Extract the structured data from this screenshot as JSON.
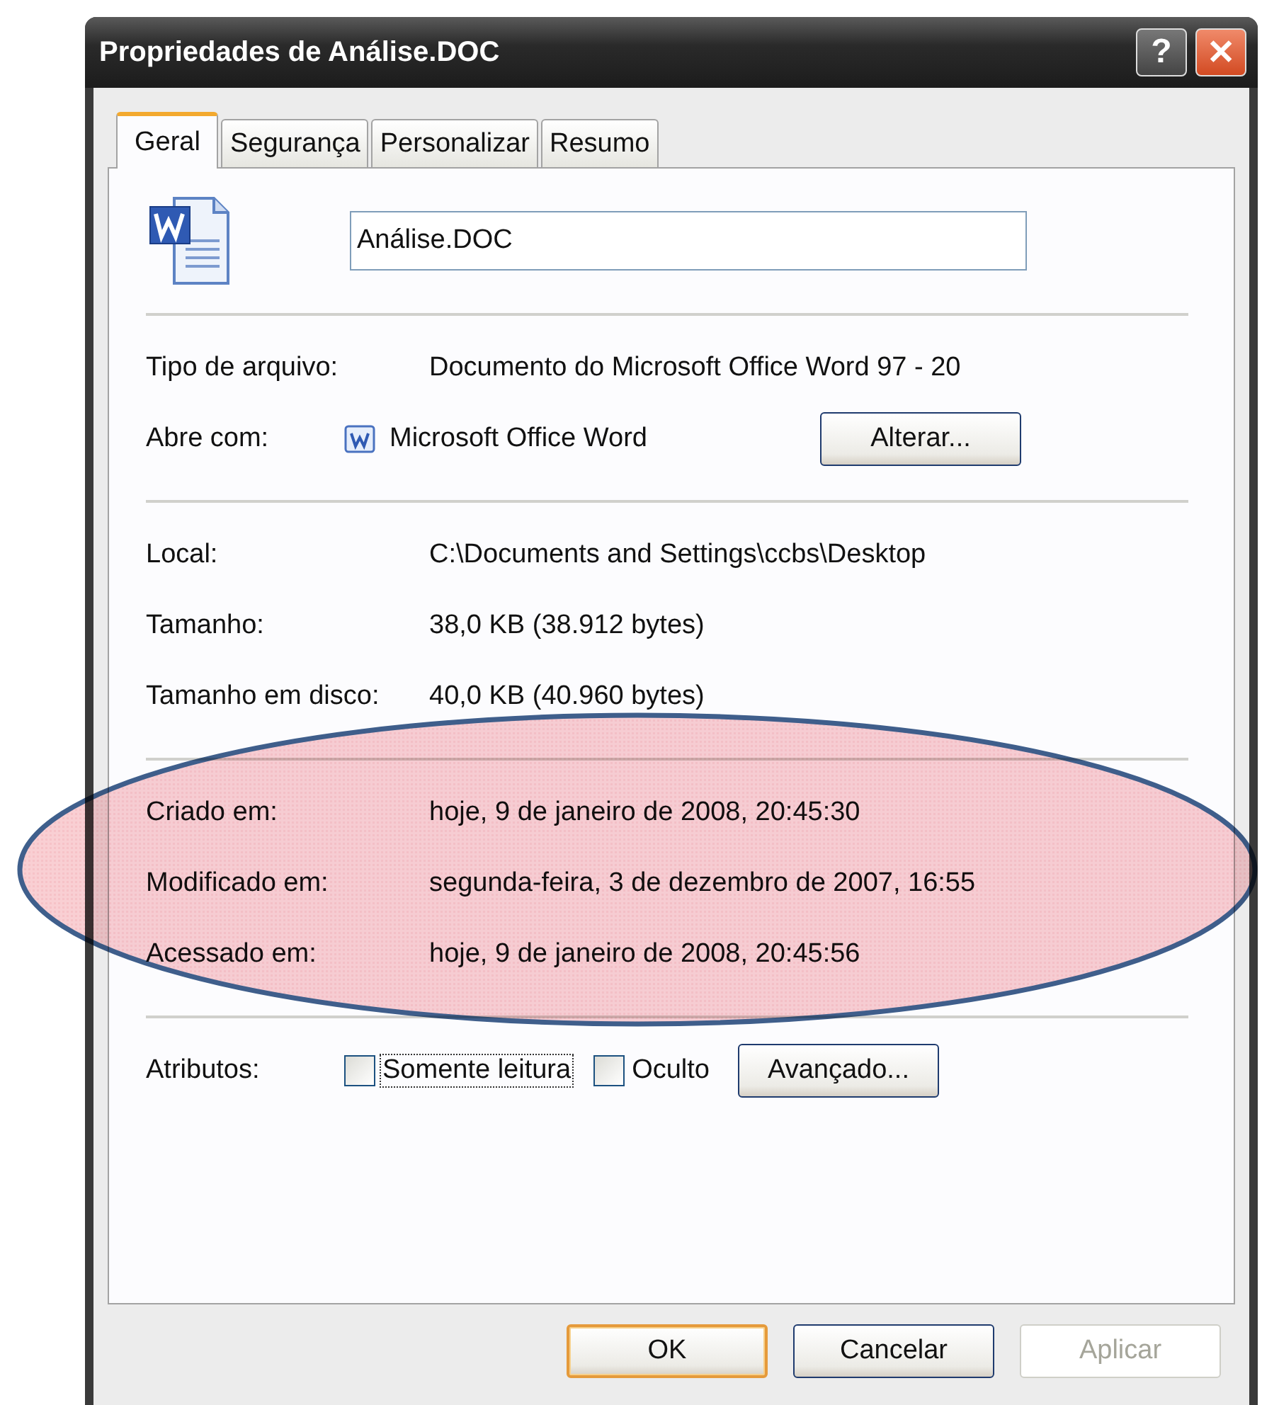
{
  "window": {
    "title": "Propriedades de Análise.DOC",
    "title_buttons": [
      {
        "kind": "help",
        "label": "?"
      },
      {
        "kind": "close",
        "label": "✕"
      }
    ]
  },
  "tabs": [
    {
      "label": "Geral",
      "selected": true
    },
    {
      "label": "Segurança",
      "selected": false
    },
    {
      "label": "Personalizar",
      "selected": false
    },
    {
      "label": "Resumo",
      "selected": false
    }
  ],
  "file_name": {
    "value": "Análise.DOC"
  },
  "type_section": [
    {
      "label": "Tipo de arquivo:",
      "value": "Documento do Microsoft Office Word 97 - 20"
    },
    {
      "label": "Abre com:",
      "value": "Microsoft Office Word",
      "button": "Alterar..."
    }
  ],
  "location_section": [
    {
      "label": "Local:",
      "value": "C:\\Documents and Settings\\ccbs\\Desktop"
    },
    {
      "label": "Tamanho:",
      "value": "38,0 KB (38.912 bytes)"
    },
    {
      "label": "Tamanho em disco:",
      "value": "40,0 KB (40.960 bytes)"
    }
  ],
  "dates_section": [
    {
      "label": "Criado em:",
      "value": "hoje, 9 de janeiro de 2008, 20:45:30"
    },
    {
      "label": "Modificado em:",
      "value": "segunda-feira, 3 de dezembro de 2007, 16:55"
    },
    {
      "label": "Acessado em:",
      "value": "hoje, 9 de janeiro de 2008, 20:45:56"
    }
  ],
  "attributes": {
    "label": "Atributos:",
    "checkboxes": [
      {
        "label": "Somente leitura",
        "checked": false,
        "focused": true
      },
      {
        "label": "Oculto",
        "checked": false,
        "focused": false
      }
    ],
    "button": "Avançado..."
  },
  "buttons": [
    {
      "label": "OK",
      "default": true,
      "disabled": false
    },
    {
      "label": "Cancelar",
      "default": false,
      "disabled": false
    },
    {
      "label": "Aplicar",
      "default": false,
      "disabled": true
    }
  ]
}
